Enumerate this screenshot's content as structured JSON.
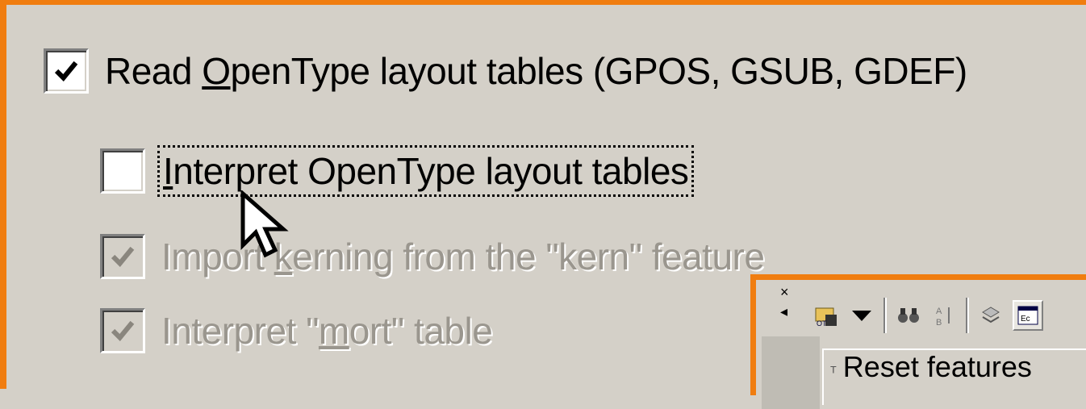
{
  "options": [
    {
      "prefix": "Read ",
      "mnemonic": "O",
      "suffix": "penType layout tables (GPOS, GSUB, GDEF)",
      "checked": true,
      "enabled": true
    },
    {
      "prefix": "",
      "mnemonic": "I",
      "suffix": "nterpret OpenType layout tables",
      "checked": false,
      "enabled": true,
      "focused": true
    },
    {
      "prefix": "Import ",
      "mnemonic": "k",
      "suffix": "erning from the \"kern\" feature",
      "checked": true,
      "enabled": false
    },
    {
      "prefix": "Interpret \"",
      "mnemonic": "m",
      "suffix": "ort\" table",
      "checked": true,
      "enabled": false
    }
  ],
  "toolbar": {
    "close_glyph": "×",
    "left_glyph": "◂",
    "icons": [
      "open-ot-icon",
      "dropdown-arrow-icon",
      "binoculars-icon",
      "sort-icon",
      "layers-icon",
      "features-panel-icon"
    ]
  },
  "features_panel": {
    "icon_text": "ᵀ",
    "label": "Reset features"
  },
  "colors": {
    "accent": "#f07d10",
    "face": "#d4d0c8",
    "disabled_text": "#9a968e"
  }
}
